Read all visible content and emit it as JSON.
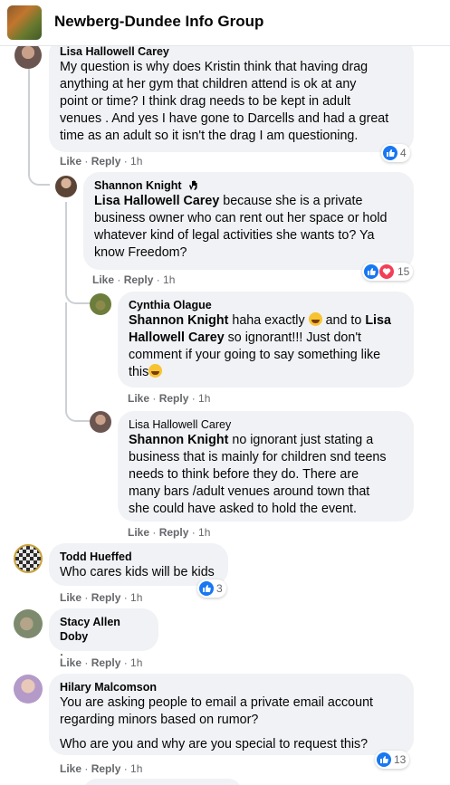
{
  "header": {
    "group_name": "Newberg-Dundee Info Group"
  },
  "actions": {
    "like": "Like",
    "reply": "Reply",
    "separator": " · "
  },
  "comments": [
    {
      "author": "Lisa Hallowell Carey",
      "lines": [
        "My question is why does Kristin think that having drag",
        "anything at her gym that children attend is ok at any",
        "point or time? I think drag needs to be kept in adult",
        "venues . And yes I have gone to Darcells and had a great",
        "time as an adult so it isn't the drag I am questioning."
      ],
      "time": "1h",
      "reactions": "4"
    },
    {
      "author": "Shannon Knight",
      "mention": "Lisa Hallowell Carey",
      "lines": [
        " because she is a private",
        "business owner who can rent out her space or hold",
        "whatever kind of legal activities she wants to? Ya",
        "know Freedom?"
      ],
      "time": "1h",
      "reactions": "15"
    },
    {
      "author": "Cynthia Olague",
      "mention1": "Shannon Knight",
      "text1": " haha exactly ",
      "text2": " and to ",
      "mention2": "Lisa",
      "mention3": "Hallowell Carey",
      "text3": " so ignorant!!! Just don't",
      "line3": "comment if your going to say something like",
      "line4": "this",
      "time": "1h"
    },
    {
      "author": "Lisa Hallowell Carey",
      "mention": "Shannon Knight",
      "lines": [
        " no ignorant just stating a",
        "business that is mainly for children snd teens",
        "needs to think before they do. There are",
        "many bars /adult venues around town that",
        "she could have asked to hold the event."
      ],
      "time": "1h"
    },
    {
      "author": "Todd Hueffed",
      "lines": [
        "Who cares kids will be kids"
      ],
      "time": "1h",
      "reactions": "3"
    },
    {
      "author": "Stacy Allen Doby",
      "lines": [
        "."
      ],
      "time": "1h"
    },
    {
      "author": "Hilary Malcomson",
      "lines": [
        "You are asking people to email a private email account",
        "regarding minors based on rumor?",
        "Who are you and why are you special to request this?"
      ],
      "time": "1h",
      "reactions": "13"
    }
  ],
  "colors": {
    "like_blue": "#1877f2",
    "love_red": "#f33e58",
    "bubble": "#f0f2f5",
    "meta": "#65676b"
  }
}
